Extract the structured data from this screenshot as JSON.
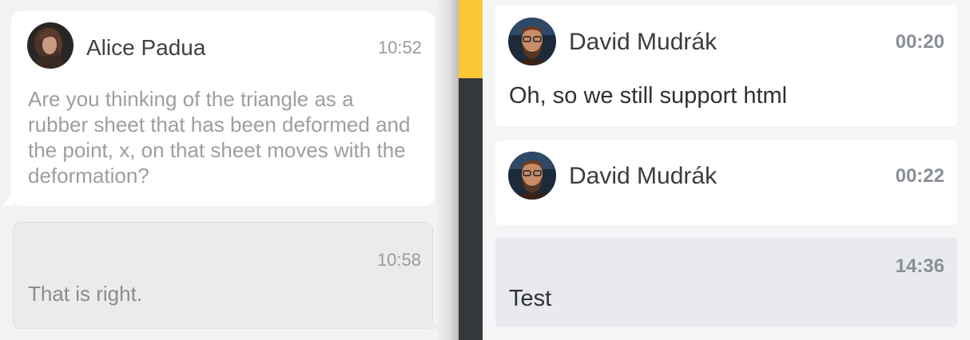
{
  "left_chat": {
    "incoming": {
      "sender": "Alice Padua",
      "time": "10:52",
      "text": "Are you thinking of the triangle as a rubber sheet that has been deformed and the point, x, on that sheet moves with the deformation?",
      "avatar_icon": "user-avatar-photo"
    },
    "outgoing": {
      "time": "10:58",
      "text": "That is right."
    }
  },
  "right_chat": {
    "messages": [
      {
        "sender": "David Mudrák",
        "time": "00:20",
        "text": "Oh, so we still support html",
        "avatar_icon": "user-avatar-photo"
      },
      {
        "sender": "David Mudrák",
        "time": "00:22",
        "text": "",
        "avatar_icon": "user-avatar-photo"
      },
      {
        "sender": "",
        "time": "14:36",
        "text": "Test"
      }
    ]
  },
  "colors": {
    "accent": "#fac735",
    "divider": "#35393d",
    "outgoing_bubble_left": "#ebebeb",
    "outgoing_card_right": "#e8eaed"
  }
}
